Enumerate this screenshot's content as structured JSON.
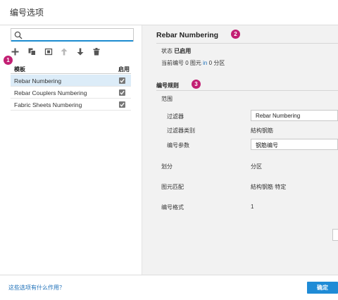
{
  "window": {
    "title": "编号选项"
  },
  "left_panel": {
    "search_placeholder": "",
    "toolbar": [
      {
        "icon": "add-icon"
      },
      {
        "icon": "copy-icon"
      },
      {
        "icon": "rename-icon"
      },
      {
        "icon": "move-up-icon"
      },
      {
        "icon": "move-down-icon"
      },
      {
        "icon": "delete-icon"
      }
    ],
    "header": {
      "template": "模板",
      "enabled": "启用"
    },
    "rows": [
      {
        "name": "Rebar Numbering",
        "enabled": true,
        "selected": true
      },
      {
        "name": "Rebar Couplers Numbering",
        "enabled": true,
        "selected": false
      },
      {
        "name": "Fabric Sheets Numbering",
        "enabled": true,
        "selected": false
      }
    ],
    "callout": "1"
  },
  "right_panel": {
    "title": "Rebar Numbering",
    "title_callout": "2",
    "status_label": "状态",
    "status_value": "已启用",
    "current_prefix": "当前编号",
    "current_count1": "0",
    "current_unit1": "图元",
    "current_in": "in",
    "current_count2": "0",
    "current_unit2": "分区",
    "rules_title": "编号规则",
    "rules_callout": "3",
    "scope_label": "范围",
    "filter_label": "过滤器",
    "filter_value": "Rebar Numbering",
    "filter_category_label": "过滤器类别",
    "filter_category_value": "結构钢筋",
    "param_label": "编号参数",
    "param_value": "钢筋编号",
    "partition_label": "划分",
    "partition_value": "分区",
    "match_label": "图元匹配",
    "match_value": "結构钢筋 特定",
    "format_label": "编号格式",
    "format_value": "1"
  },
  "footer": {
    "help_link": "这些选项有什么作用？",
    "ok_label": "确定"
  },
  "colors": {
    "accent": "#1f8bd6",
    "callout": "#c21f73",
    "selected_row": "#dcecf8",
    "right_bg": "#f2f2f2"
  }
}
